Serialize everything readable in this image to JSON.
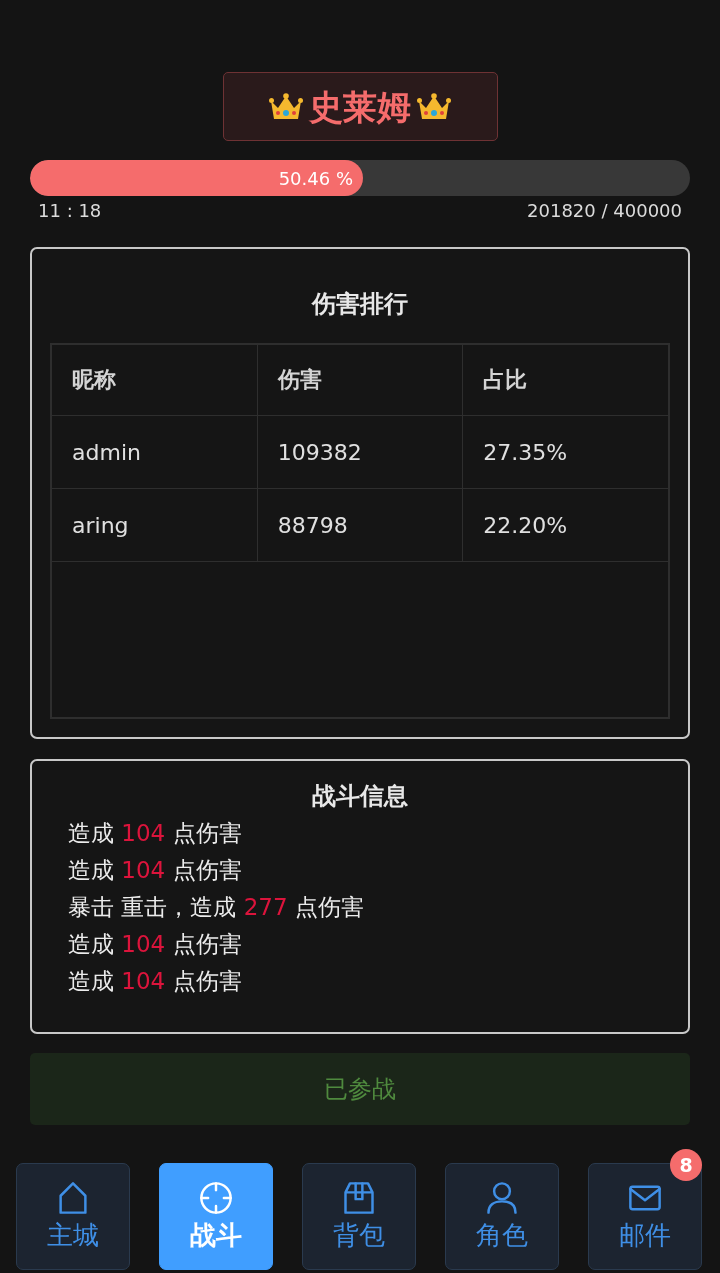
{
  "boss": {
    "name": "史莱姆",
    "progress": {
      "level": 0.5046,
      "reading": "50.46 %"
    },
    "timer": "11 : 18",
    "hp": "201820 / 400000"
  },
  "ranking": {
    "title": "伤害排行",
    "columns": [
      "昵称",
      "伤害",
      "占比"
    ],
    "rows": [
      [
        "admin",
        "109382",
        "27.35%"
      ],
      [
        "aring",
        "88798",
        "22.20%"
      ]
    ]
  },
  "battle_log": {
    "title": "战斗信息",
    "lines": [
      {
        "text": "造成",
        "amount": "104",
        "suffix": "点伤害"
      },
      {
        "text": "造成",
        "amount": "104",
        "suffix": "点伤害"
      },
      {
        "text": "暴击 重击，造成",
        "amount": "277",
        "suffix": "点伤害"
      },
      {
        "text": "造成",
        "amount": "104",
        "suffix": "点伤害"
      },
      {
        "text": "造成",
        "amount": "104",
        "suffix": "点伤害"
      }
    ]
  },
  "join_button": {
    "label": "已参战",
    "disabled": true
  },
  "nav": [
    {
      "label": "主城",
      "selected": false
    },
    {
      "label": "战斗",
      "selected": true
    },
    {
      "label": "背包",
      "selected": false
    },
    {
      "label": "角色",
      "selected": false
    },
    {
      "label": "邮件",
      "selected": false,
      "badge": "8"
    }
  ]
}
